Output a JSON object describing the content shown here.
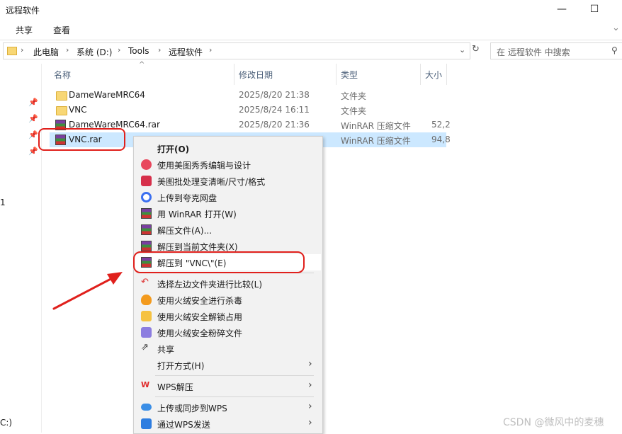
{
  "window": {
    "title": "远程软件",
    "min_glyph": "—",
    "max_glyph": "☐"
  },
  "ribbon": {
    "tabs": [
      "共享",
      "查看"
    ],
    "collapse_glyph": "⌄"
  },
  "address": {
    "crumbs": [
      "此电脑",
      "系统 (D:)",
      "Tools",
      "远程软件"
    ],
    "search_placeholder": "在 远程软件 中搜索"
  },
  "columns": {
    "name": "名称",
    "date": "修改日期",
    "type": "类型",
    "size": "大小"
  },
  "files": [
    {
      "name": "DameWareMRC64",
      "date": "2025/8/20 21:38",
      "type": "文件夹",
      "size": "",
      "icon": "folder-icon"
    },
    {
      "name": "VNC",
      "date": "2025/8/24 16:11",
      "type": "文件夹",
      "size": "",
      "icon": "folder-icon"
    },
    {
      "name": "DameWareMRC64.rar",
      "date": "2025/8/20 21:36",
      "type": "WinRAR 压缩文件",
      "size": "52,2",
      "icon": "winrar-icon"
    },
    {
      "name": "VNC.rar",
      "date": "",
      "type": "WinRAR 压缩文件",
      "size": "94,8",
      "icon": "winrar-icon",
      "selected": true
    }
  ],
  "leftnav_fragments": [
    "1",
    "C:)"
  ],
  "context_menu": {
    "items": [
      {
        "label": "打开(O)",
        "icon": "",
        "bold": true
      },
      {
        "label": "使用美图秀秀编辑与设计",
        "icon": "meitu-icon"
      },
      {
        "label": "美图批处理变清晰/尺寸/格式",
        "icon": "meitu-batch-icon"
      },
      {
        "label": "上传到夸克网盘",
        "icon": "quark-icon"
      },
      {
        "label": "用 WinRAR 打开(W)",
        "icon": "winrar-icon"
      },
      {
        "label": "解压文件(A)...",
        "icon": "winrar-icon"
      },
      {
        "label": "解压到当前文件夹(X)",
        "icon": "winrar-icon"
      },
      {
        "label": "解压到 \"VNC\\\"(E)",
        "icon": "winrar-icon",
        "highlighted": true
      },
      {
        "label": "选择左边文件夹进行比较(L)",
        "icon": "compare-icon"
      },
      {
        "label": "使用火绒安全进行杀毒",
        "icon": "huorong-icon"
      },
      {
        "label": "使用火绒安全解锁占用",
        "icon": "unlock-folder-icon"
      },
      {
        "label": "使用火绒安全粉碎文件",
        "icon": "shred-icon"
      },
      {
        "label": "共享",
        "icon": "share-icon"
      },
      {
        "label": "打开方式(H)",
        "icon": "",
        "submenu": true
      },
      {
        "label": "WPS解压",
        "icon": "wps-icon",
        "submenu": true
      },
      {
        "label": "上传或同步到WPS",
        "icon": "cloud-icon",
        "submenu": true
      },
      {
        "label": "通过WPS发送",
        "icon": "wps-send-icon",
        "submenu": true
      }
    ]
  },
  "watermark": "CSDN @微风中的麦穗",
  "colors": {
    "selection": "#cce8ff",
    "annotation": "#e0201c"
  }
}
